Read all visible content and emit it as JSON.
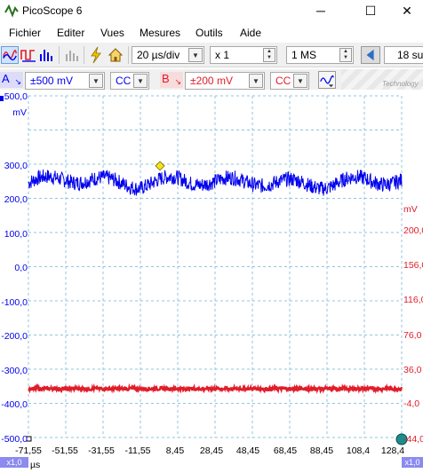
{
  "window": {
    "title": "PicoScope 6",
    "minimize": "─",
    "maximize": "☐",
    "close": "✕"
  },
  "menu": [
    "Fichier",
    "Editer",
    "Vues",
    "Mesures",
    "Outils",
    "Aide"
  ],
  "toolbar": {
    "timebase": "20 µs/div",
    "zoom": "x 1",
    "samples": "1 MS",
    "captures": "18 su"
  },
  "channels": {
    "a": {
      "letter": "A",
      "range": "±500 mV",
      "coupling": "CC",
      "color": "#0000ee"
    },
    "b": {
      "letter": "B",
      "range": "±200 mV",
      "coupling": "CC",
      "color": "#e11d2a"
    }
  },
  "watermark": "Technology",
  "scope": {
    "left_axis": {
      "unit": "mV",
      "labels": [
        "500,0",
        "300,0",
        "200,0",
        "100,0",
        "0,0",
        "-100,0",
        "-200,0",
        "-300,0",
        "-400,0",
        "-500,0"
      ]
    },
    "right_axis": {
      "unit": "mV",
      "labels": [
        "200,0",
        "156,0",
        "116,0",
        "76,0",
        "36,0",
        "-4,0",
        "-44,0"
      ]
    },
    "x_axis": {
      "unit": "µs",
      "labels": [
        "-71,55",
        "-51,55",
        "-31,55",
        "-11,55",
        "8,45",
        "28,45",
        "48,45",
        "68,45",
        "88,45",
        "108,4",
        "128,4"
      ]
    },
    "zoom_left": "x1,0",
    "zoom_right": "x1,0"
  },
  "chart_data": {
    "type": "line",
    "x": [
      -71.55,
      -51.55,
      -31.55,
      -11.55,
      8.45,
      28.45,
      48.45,
      68.45,
      88.45,
      108.45,
      128.45
    ],
    "xlabel": "µs",
    "ylabel": "mV",
    "series": [
      {
        "name": "A",
        "color": "#0000ee",
        "values": [
          245,
          260,
          250,
          240,
          255,
          248,
          250,
          244,
          240,
          255,
          250
        ],
        "ylim": [
          -500,
          500
        ]
      },
      {
        "name": "B",
        "color": "#e11d2a",
        "values": [
          -4,
          -4,
          -4,
          -4,
          -4,
          -4,
          -4,
          -4,
          -4,
          -4,
          -4
        ],
        "ylim": [
          -44,
          236
        ]
      }
    ],
    "grid": true
  }
}
